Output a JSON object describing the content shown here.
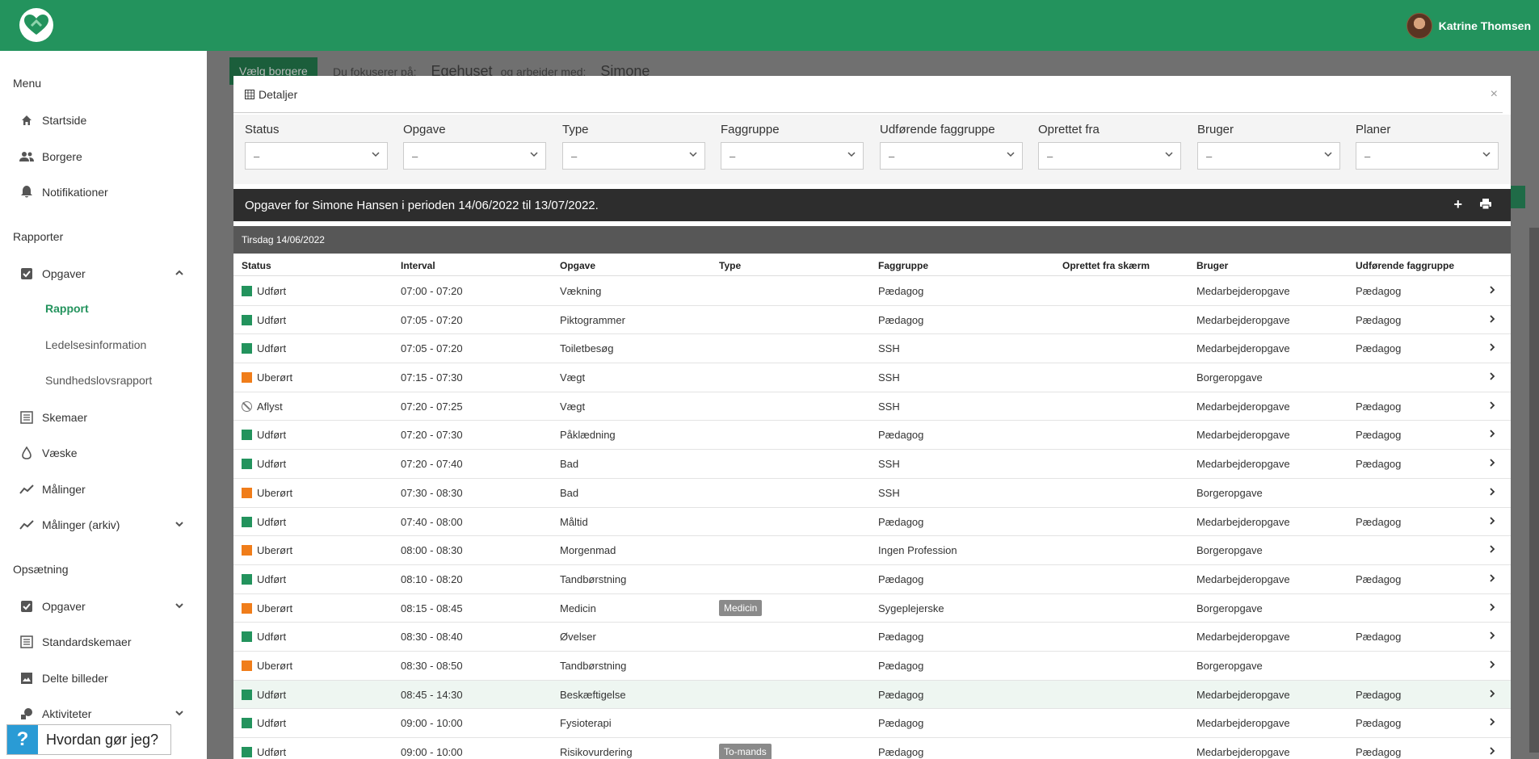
{
  "user": {
    "name": "Katrine Thomsen"
  },
  "sidebar": {
    "menu_title": "Menu",
    "items_main": [
      {
        "label": "Startside",
        "icon": "home-icon"
      },
      {
        "label": "Borgere",
        "icon": "people-icon"
      },
      {
        "label": "Notifikationer",
        "icon": "bell-icon"
      }
    ],
    "reports_title": "Rapporter",
    "opgaver_label": "Opgaver",
    "sub_items": [
      "Rapport",
      "Ledelsesinformation",
      "Sundhedslovsrapport"
    ],
    "items_reports": [
      {
        "label": "Skemaer"
      },
      {
        "label": "Væske"
      },
      {
        "label": "Målinger"
      },
      {
        "label": "Målinger (arkiv)"
      }
    ],
    "setup_title": "Opsætning",
    "items_setup": [
      {
        "label": "Opgaver"
      },
      {
        "label": "Standardskemaer"
      },
      {
        "label": "Delte billeder"
      },
      {
        "label": "Aktiviteter"
      }
    ]
  },
  "help": {
    "icon": "?",
    "label": "Hvordan gør jeg?"
  },
  "background": {
    "button": "Vælg borgere",
    "focus_prefix": "Du fokuserer på:",
    "focus_value": "Egehuset",
    "work_prefix": "og arbejder med:",
    "work_value": "Simone"
  },
  "modal": {
    "title": "Detaljer",
    "close": "×",
    "filters": [
      {
        "label": "Status",
        "value": "–"
      },
      {
        "label": "Opgave",
        "value": "–"
      },
      {
        "label": "Type",
        "value": "–"
      },
      {
        "label": "Faggruppe",
        "value": "–"
      },
      {
        "label": "Udførende faggruppe",
        "value": "–"
      },
      {
        "label": "Oprettet fra",
        "value": "–"
      },
      {
        "label": "Bruger",
        "value": "–"
      },
      {
        "label": "Planer",
        "value": "–"
      }
    ],
    "table_title": "Opgaver for  Simone Hansen i perioden 14/06/2022 til 13/07/2022.",
    "day_header": "Tirsdag 14/06/2022",
    "columns": [
      "Status",
      "Interval",
      "Opgave",
      "Type",
      "Faggruppe",
      "Oprettet fra skærm",
      "Bruger",
      "Udførende faggruppe"
    ],
    "rows": [
      {
        "status": "Udført",
        "state": "green",
        "interval": "07:00 - 07:20",
        "task": "Vækning",
        "type": "",
        "group": "Pædagog",
        "user": "Medarbejderopgave",
        "exec": "Pædagog"
      },
      {
        "status": "Udført",
        "state": "green",
        "interval": "07:05 - 07:20",
        "task": "Piktogrammer",
        "type": "",
        "group": "Pædagog",
        "user": "Medarbejderopgave",
        "exec": "Pædagog"
      },
      {
        "status": "Udført",
        "state": "green",
        "interval": "07:05 - 07:20",
        "task": "Toiletbesøg",
        "type": "",
        "group": "SSH",
        "user": "Medarbejderopgave",
        "exec": "Pædagog"
      },
      {
        "status": "Uberørt",
        "state": "orange",
        "interval": "07:15 - 07:30",
        "task": "Vægt",
        "type": "",
        "group": "SSH",
        "user": "Borgeropgave",
        "exec": ""
      },
      {
        "status": "Aflyst",
        "state": "cancel",
        "interval": "07:20 - 07:25",
        "task": "Vægt",
        "type": "",
        "group": "SSH",
        "user": "Medarbejderopgave",
        "exec": "Pædagog"
      },
      {
        "status": "Udført",
        "state": "green",
        "interval": "07:20 - 07:30",
        "task": "Påklædning",
        "type": "",
        "group": "Pædagog",
        "user": "Medarbejderopgave",
        "exec": "Pædagog"
      },
      {
        "status": "Udført",
        "state": "green",
        "interval": "07:20 - 07:40",
        "task": "Bad",
        "type": "",
        "group": "SSH",
        "user": "Medarbejderopgave",
        "exec": "Pædagog"
      },
      {
        "status": "Uberørt",
        "state": "orange",
        "interval": "07:30 - 08:30",
        "task": "Bad",
        "type": "",
        "group": "SSH",
        "user": "Borgeropgave",
        "exec": ""
      },
      {
        "status": "Udført",
        "state": "green",
        "interval": "07:40 - 08:00",
        "task": "Måltid",
        "type": "",
        "group": "Pædagog",
        "user": "Medarbejderopgave",
        "exec": "Pædagog"
      },
      {
        "status": "Uberørt",
        "state": "orange",
        "interval": "08:00 - 08:30",
        "task": "Morgenmad",
        "type": "",
        "group": "Ingen Profession",
        "user": "Borgeropgave",
        "exec": ""
      },
      {
        "status": "Udført",
        "state": "green",
        "interval": "08:10 - 08:20",
        "task": "Tandbørstning",
        "type": "",
        "group": "Pædagog",
        "user": "Medarbejderopgave",
        "exec": "Pædagog"
      },
      {
        "status": "Uberørt",
        "state": "orange",
        "interval": "08:15 - 08:45",
        "task": "Medicin",
        "type": "Medicin",
        "group": "Sygeplejerske",
        "user": "Borgeropgave",
        "exec": ""
      },
      {
        "status": "Udført",
        "state": "green",
        "interval": "08:30 - 08:40",
        "task": "Øvelser",
        "type": "",
        "group": "Pædagog",
        "user": "Medarbejderopgave",
        "exec": "Pædagog"
      },
      {
        "status": "Uberørt",
        "state": "orange",
        "interval": "08:30 - 08:50",
        "task": "Tandbørstning",
        "type": "",
        "group": "Pædagog",
        "user": "Borgeropgave",
        "exec": ""
      },
      {
        "status": "Udført",
        "state": "green",
        "interval": "08:45 - 14:30",
        "task": "Beskæftigelse",
        "type": "",
        "group": "Pædagog",
        "user": "Medarbejderopgave",
        "exec": "Pædagog",
        "highlight": true
      },
      {
        "status": "Udført",
        "state": "green",
        "interval": "09:00 - 10:00",
        "task": "Fysioterapi",
        "type": "",
        "group": "Pædagog",
        "user": "Medarbejderopgave",
        "exec": "Pædagog"
      },
      {
        "status": "Udført",
        "state": "green",
        "interval": "09:00 - 10:00",
        "task": "Risikovurdering",
        "type": "To-mands",
        "group": "Pædagog",
        "user": "Medarbejderopgave",
        "exec": "Pædagog"
      }
    ]
  },
  "colors": {
    "brand": "#23935d",
    "done": "#23935d",
    "untouched": "#f07d1a"
  }
}
